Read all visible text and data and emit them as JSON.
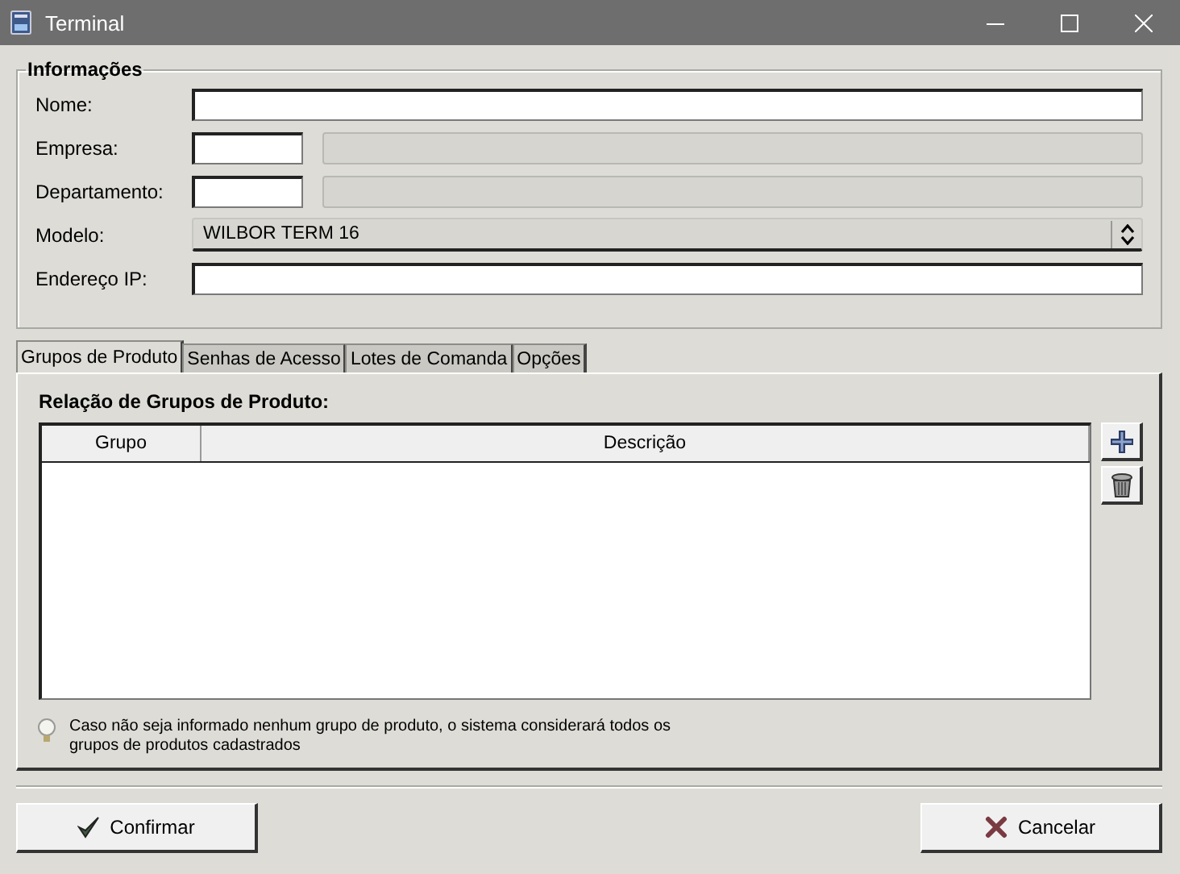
{
  "window": {
    "title": "Terminal"
  },
  "group": {
    "title": "Informações",
    "fields": [
      {
        "label": "Nome:",
        "kind": "text"
      },
      {
        "label": "Empresa:",
        "kind": "lookup"
      },
      {
        "label": "Departamento:",
        "kind": "lookup"
      },
      {
        "label": "Modelo:",
        "kind": "select",
        "value": "WILBOR TERM 16"
      },
      {
        "label": "Endereço IP:",
        "kind": "text"
      }
    ]
  },
  "tabs": [
    {
      "label": "Grupos de Produto",
      "selected": true
    },
    {
      "label": "Senhas de Acesso",
      "selected": false
    },
    {
      "label": "Lotes de Comanda",
      "selected": false
    },
    {
      "label": "Opções",
      "selected": false
    }
  ],
  "panel": {
    "heading": "Relação de Grupos de Produto:",
    "table": {
      "columns": [
        "Grupo",
        "Descrição"
      ]
    },
    "hint": "Caso não seja informado nenhum grupo de produto, o sistema considerará todos os grupos de produtos cadastrados"
  },
  "buttons": [
    {
      "label": "Confirmar",
      "kind": "confirm"
    },
    {
      "label": "Cancelar",
      "kind": "cancel"
    }
  ]
}
